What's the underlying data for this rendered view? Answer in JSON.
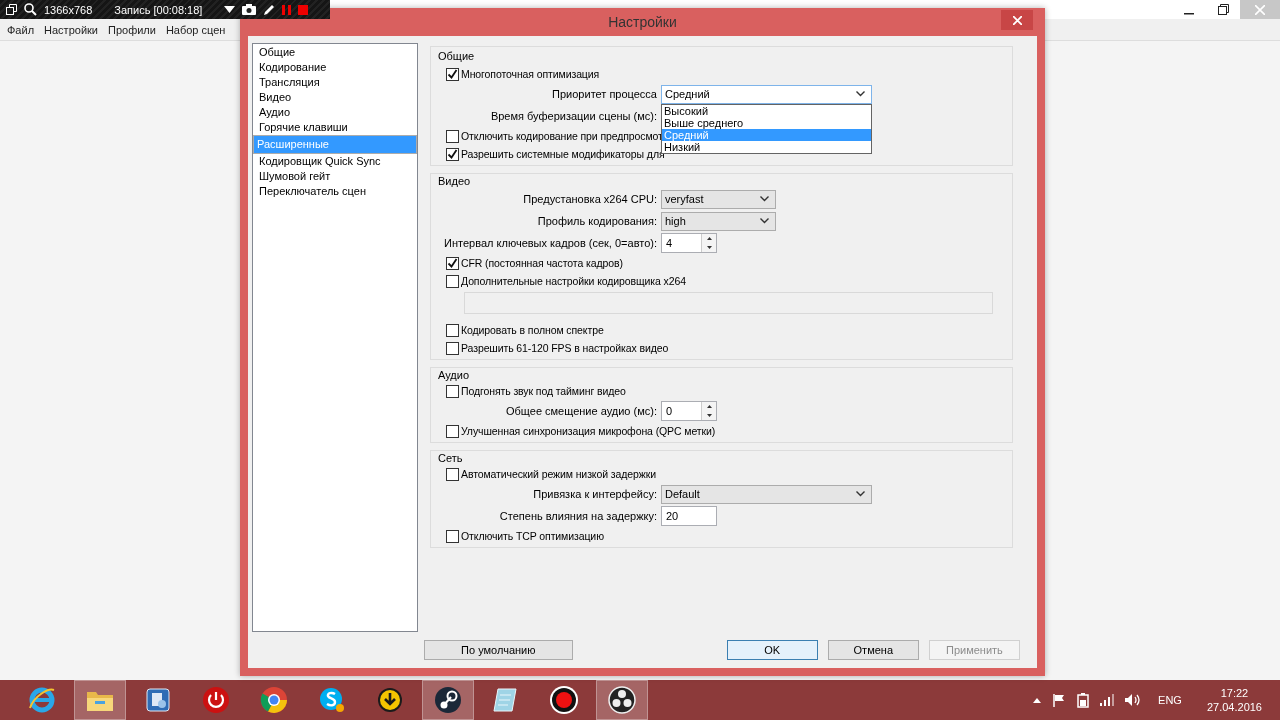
{
  "recorder": {
    "resolution": "1366x768",
    "status": "Запись [00:08:18]"
  },
  "main_window": {
    "menu": [
      "Файл",
      "Настройки",
      "Профили",
      "Набор сцен"
    ]
  },
  "dialog": {
    "title": "Настройки",
    "sidebar": {
      "items": [
        {
          "label": "Общие",
          "selected": false
        },
        {
          "label": "Кодирование",
          "selected": false
        },
        {
          "label": "Трансляция",
          "selected": false
        },
        {
          "label": "Видео",
          "selected": false
        },
        {
          "label": "Аудио",
          "selected": false
        },
        {
          "label": "Горячие клавиши",
          "selected": false
        },
        {
          "label": "Расширенные",
          "selected": true
        },
        {
          "label": "Кодировщик Quick Sync",
          "selected": false
        },
        {
          "label": "Шумовой гейт",
          "selected": false
        },
        {
          "label": "Переключатель сцен",
          "selected": false
        }
      ]
    },
    "sections": [
      {
        "title": "Общие",
        "rows": [
          {
            "kind": "checkbox",
            "label": "Многопоточная оптимизация",
            "checked": true
          },
          {
            "kind": "select",
            "label": "Приоритет процесса",
            "value": "Средний",
            "open": true,
            "options": [
              {
                "label": "Высокий",
                "selected": false
              },
              {
                "label": "Выше среднего",
                "selected": false
              },
              {
                "label": "Средний",
                "selected": true
              },
              {
                "label": "Низкий",
                "selected": false
              }
            ]
          },
          {
            "kind": "label",
            "label": "Время буферизации сцены (мс):"
          },
          {
            "kind": "checkbox",
            "label": "Отключить кодирование при предпросмот",
            "checked": false
          },
          {
            "kind": "checkbox",
            "label": "Разрешить системные модификаторы для",
            "checked": true
          }
        ]
      },
      {
        "title": "Видео",
        "rows": [
          {
            "kind": "select",
            "label": "Предустановка x264 CPU:",
            "value": "veryfast",
            "open": false
          },
          {
            "kind": "select",
            "label": "Профиль кодирования:",
            "value": "high",
            "open": false
          },
          {
            "kind": "spin",
            "label": "Интервал ключевых кадров (сек, 0=авто):",
            "value": "4"
          },
          {
            "kind": "checkbox",
            "label": "CFR (постоянная частота кадров)",
            "checked": true
          },
          {
            "kind": "checkbox",
            "label": "Дополнительные настройки кодировщика x264",
            "checked": false
          },
          {
            "kind": "area"
          },
          {
            "kind": "checkbox",
            "label": "Кодировать в полном спектре",
            "checked": false
          },
          {
            "kind": "checkbox",
            "label": "Разрешить 61-120 FPS в настройках видео",
            "checked": false
          }
        ]
      },
      {
        "title": "Аудио",
        "rows": [
          {
            "kind": "checkbox",
            "label": "Подгонять звук под тайминг видео",
            "checked": false
          },
          {
            "kind": "spin",
            "label": "Общее смещение аудио (мс):",
            "value": "0"
          },
          {
            "kind": "checkbox",
            "label": "Улучшенная синхронизация микрофона (QPC метки)",
            "checked": false
          }
        ]
      },
      {
        "title": "Сеть",
        "rows": [
          {
            "kind": "checkbox",
            "label": "Автоматический режим низкой задержки",
            "checked": false
          },
          {
            "kind": "select",
            "label": "Привязка к интерфейсу:",
            "value": "Default",
            "open": false
          },
          {
            "kind": "text",
            "label": "Степень влияния на задержку:",
            "value": "20"
          },
          {
            "kind": "checkbox",
            "label": "Отключить TCP оптимизацию",
            "checked": false
          }
        ]
      }
    ],
    "buttons": [
      {
        "label": "По умолчанию",
        "disabled": false,
        "default": false
      },
      {
        "label": "OK",
        "disabled": false,
        "default": true
      },
      {
        "label": "Отмена",
        "disabled": false,
        "default": false
      },
      {
        "label": "Применить",
        "disabled": true,
        "default": false
      }
    ]
  },
  "taskbar": {
    "apps": [
      {
        "kind": "ie",
        "active": false
      },
      {
        "kind": "folder",
        "active": true
      },
      {
        "kind": "tool",
        "active": false
      },
      {
        "kind": "power",
        "active": false
      },
      {
        "kind": "chrome",
        "active": false
      },
      {
        "kind": "skype",
        "active": false
      },
      {
        "kind": "download",
        "active": false
      },
      {
        "kind": "steam",
        "active": true
      },
      {
        "kind": "notepad",
        "active": false
      },
      {
        "kind": "record",
        "active": false
      },
      {
        "kind": "obs",
        "active": true
      }
    ],
    "tray": {
      "language": "ENG",
      "time": "17:22",
      "date": "27.04.2016"
    }
  }
}
